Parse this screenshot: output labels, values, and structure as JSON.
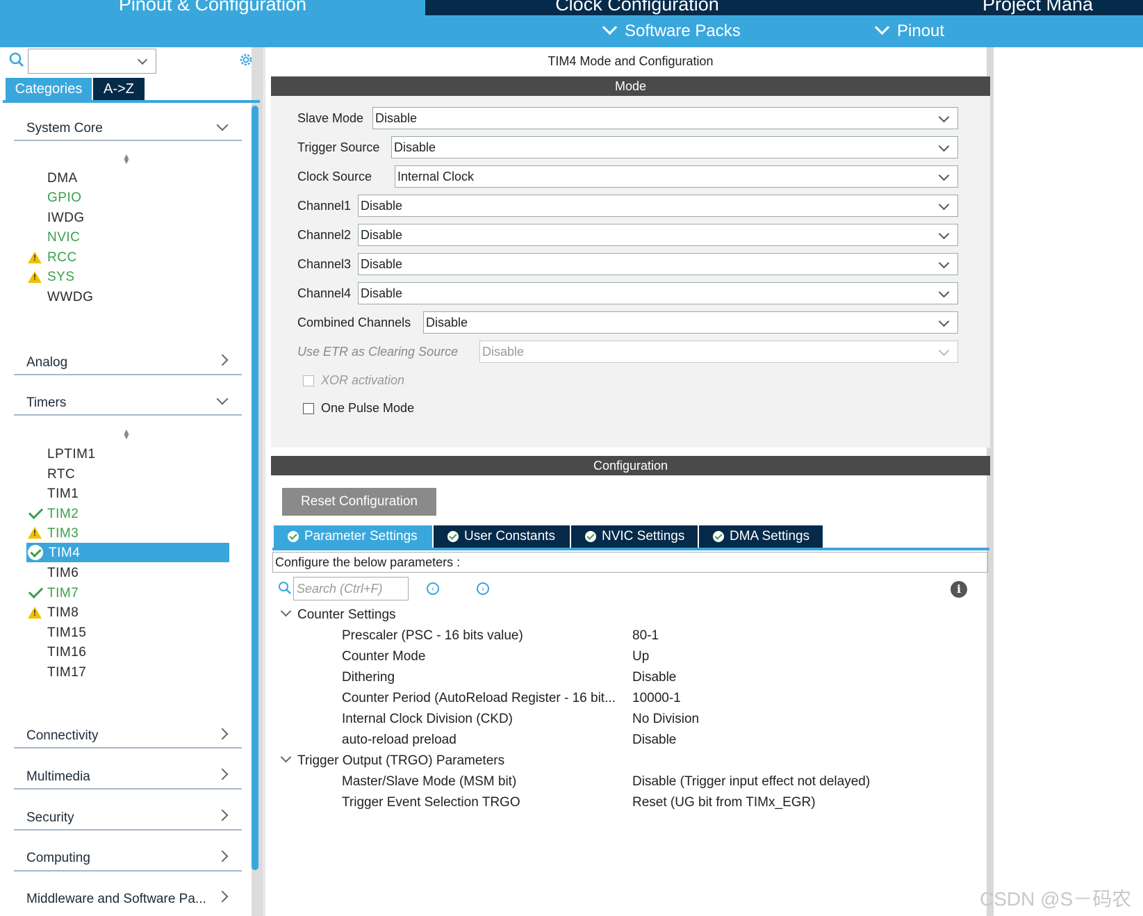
{
  "top_tabs": {
    "pinout_config": "Pinout & Configuration",
    "clock_config": "Clock Configuration",
    "project_manager": "Project Mana"
  },
  "sub_menu": {
    "software_packs": "Software Packs",
    "pinout": "Pinout"
  },
  "sidebar": {
    "search_value": "",
    "tabs": {
      "categories": "Categories",
      "a_to_z": "A->Z"
    },
    "sections": {
      "system_core": "System Core",
      "analog": "Analog",
      "timers": "Timers",
      "connectivity": "Connectivity",
      "multimedia": "Multimedia",
      "security": "Security",
      "computing": "Computing",
      "middleware": "Middleware and Software Pa..."
    },
    "system_core_items": [
      "DMA",
      "GPIO",
      "IWDG",
      "NVIC",
      "RCC",
      "SYS",
      "WWDG"
    ],
    "timer_items": [
      "LPTIM1",
      "RTC",
      "TIM1",
      "TIM2",
      "TIM3",
      "TIM4",
      "TIM6",
      "TIM7",
      "TIM8",
      "TIM15",
      "TIM16",
      "TIM17"
    ],
    "selected_item": "TIM4"
  },
  "main": {
    "title": "TIM4 Mode and Configuration",
    "mode_header": "Mode",
    "mode_rows": [
      {
        "label": "Slave Mode",
        "value": "Disable"
      },
      {
        "label": "Trigger Source",
        "value": "Disable"
      },
      {
        "label": "Clock Source",
        "value": "Internal Clock"
      },
      {
        "label": "Channel1",
        "value": "Disable"
      },
      {
        "label": "Channel2",
        "value": "Disable"
      },
      {
        "label": "Channel3",
        "value": "Disable"
      },
      {
        "label": "Channel4",
        "value": "Disable"
      },
      {
        "label": "Combined Channels",
        "value": "Disable"
      },
      {
        "label": "Use ETR as Clearing Source",
        "value": "Disable"
      }
    ],
    "xor_activation": "XOR activation",
    "one_pulse_mode": "One Pulse Mode",
    "config_header": "Configuration",
    "reset_button": "Reset Configuration",
    "param_tabs": [
      "Parameter Settings",
      "User Constants",
      "NVIC Settings",
      "DMA Settings"
    ],
    "configure_text": "Configure the below parameters :",
    "search_placeholder": "Search (Ctrl+F)",
    "groups": [
      {
        "name": "Counter Settings",
        "params": [
          {
            "name": "Prescaler (PSC - 16 bits value)",
            "value": "80-1"
          },
          {
            "name": "Counter Mode",
            "value": "Up"
          },
          {
            "name": "Dithering",
            "value": "Disable"
          },
          {
            "name": "Counter Period (AutoReload Register - 16 bit...",
            "value": "10000-1"
          },
          {
            "name": "Internal Clock Division (CKD)",
            "value": "No Division"
          },
          {
            "name": "auto-reload preload",
            "value": "Disable"
          }
        ]
      },
      {
        "name": "Trigger Output (TRGO) Parameters",
        "params": [
          {
            "name": "Master/Slave Mode (MSM bit)",
            "value": "Disable (Trigger input effect not delayed)"
          },
          {
            "name": "Trigger Event Selection TRGO",
            "value": "Reset (UG bit from TIMx_EGR)"
          }
        ]
      }
    ]
  },
  "watermark": "CSDN @S－码农",
  "colors": {
    "accent": "#3aa7dc",
    "dark_navy": "#062a4a",
    "green": "#3aa04a",
    "warning": "#f0c000"
  }
}
